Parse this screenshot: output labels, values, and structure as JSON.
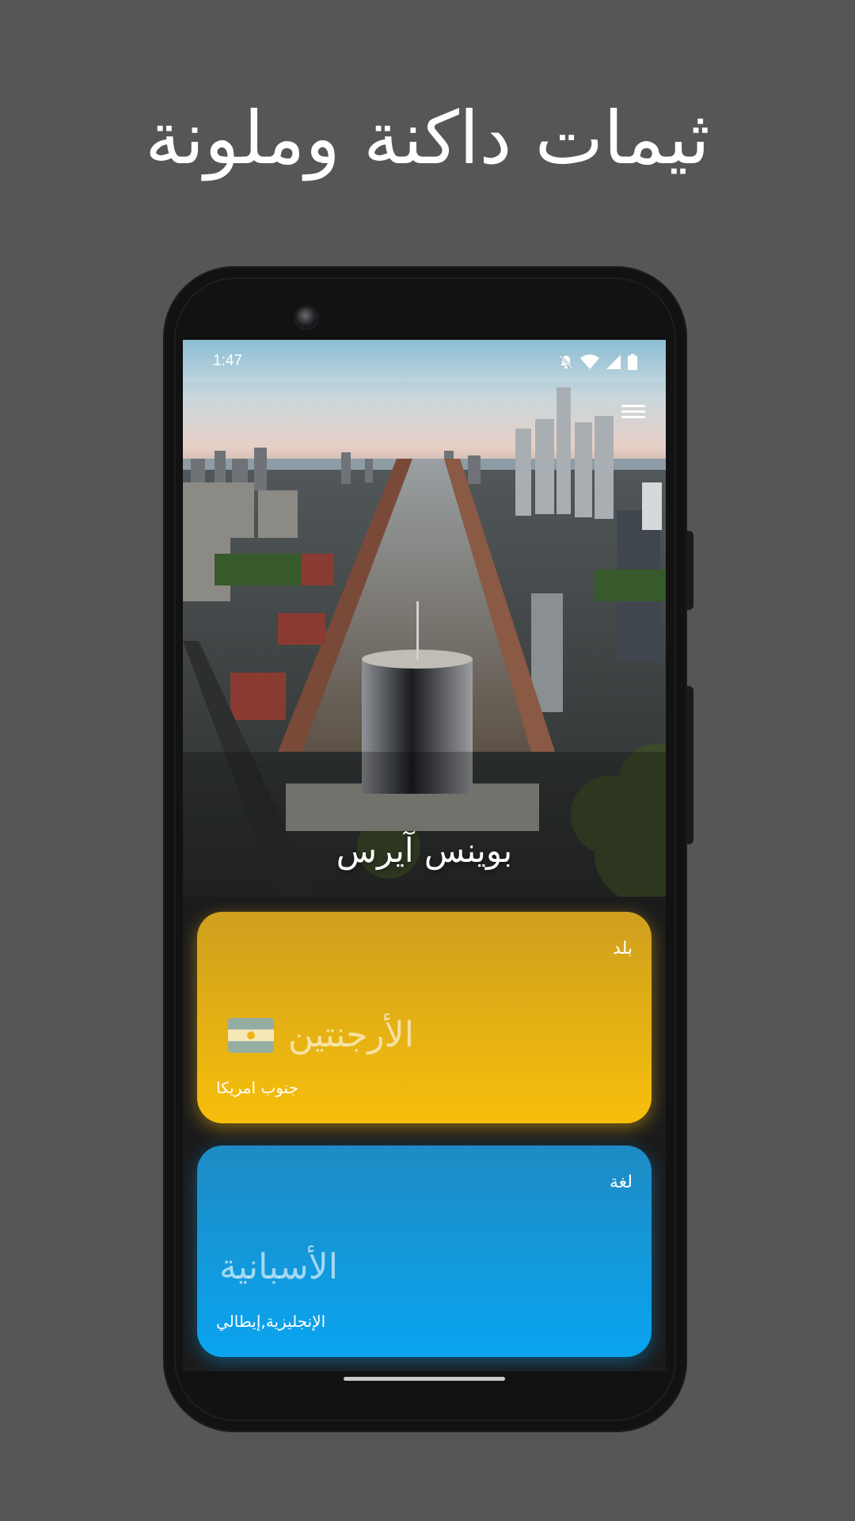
{
  "headline": "ثيمات داكنة وملونة",
  "status_bar": {
    "time": "1:47",
    "icons": [
      "notifications-off-icon",
      "wifi-icon",
      "cellular-signal-icon",
      "battery-icon"
    ]
  },
  "hero": {
    "city": "بوينس آيرس",
    "menu_icon": "hamburger-menu-icon"
  },
  "country_card": {
    "label": "بلد",
    "value": "الأرجنتين",
    "flag": "argentina-flag",
    "subtitle": "جنوب امريكا",
    "color": "#f7bf0b"
  },
  "language_card": {
    "label": "لغة",
    "value": "الأسبانية",
    "subtitle": "الإنجليزية,إيطالي",
    "color": "#09a4ef"
  }
}
